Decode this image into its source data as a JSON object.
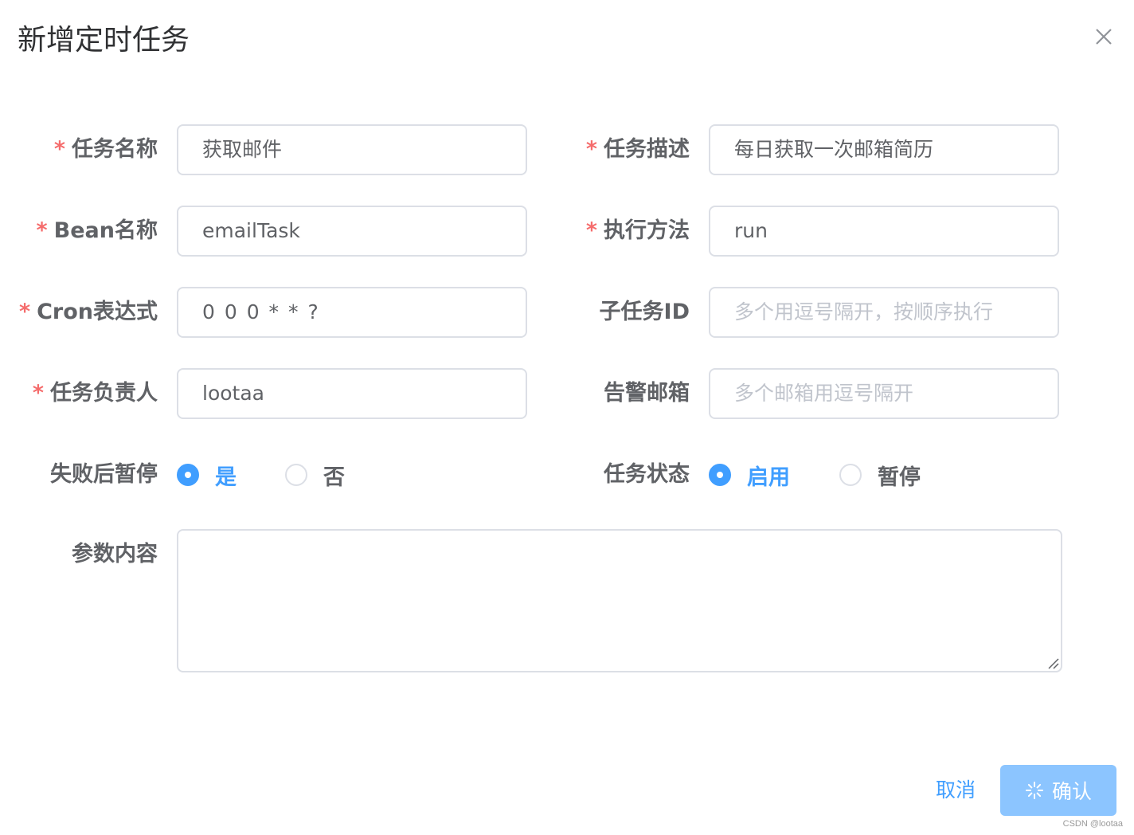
{
  "dialog": {
    "title": "新增定时任务",
    "close_icon": "close-icon"
  },
  "fields": {
    "task_name": {
      "required_mark": "*",
      "label": "任务名称",
      "value": "获取邮件"
    },
    "task_desc": {
      "required_mark": "*",
      "label": "任务描述",
      "value": "每日获取一次邮箱简历"
    },
    "bean_name": {
      "required_mark": "*",
      "label": "Bean名称",
      "value": "emailTask"
    },
    "method": {
      "required_mark": "*",
      "label": "执行方法",
      "value": "run"
    },
    "cron": {
      "required_mark": "*",
      "label": "Cron表达式",
      "value": "0 0 0 * * ?"
    },
    "sub_task": {
      "label": "子任务ID",
      "placeholder": "多个用逗号隔开，按顺序执行"
    },
    "owner": {
      "required_mark": "*",
      "label": "任务负责人",
      "value": "lootaa"
    },
    "alarm_email": {
      "label": "告警邮箱",
      "placeholder": "多个邮箱用逗号隔开"
    },
    "pause_on_fail": {
      "label": "失败后暂停",
      "options": [
        "是",
        "否"
      ],
      "selected": "是"
    },
    "status": {
      "label": "任务状态",
      "options": [
        "启用",
        "暂停"
      ],
      "selected": "启用"
    },
    "params": {
      "label": "参数内容",
      "value": ""
    }
  },
  "footer": {
    "cancel_label": "取消",
    "confirm_label": "确认",
    "confirm_loading_icon": "loading-icon"
  },
  "watermark": "CSDN @lootaa",
  "colors": {
    "primary": "#409eff",
    "primary_light": "#8cc5ff",
    "required": "#f56c6c",
    "border": "#dcdfe6",
    "placeholder": "#c0c4cc",
    "label": "#606266"
  }
}
